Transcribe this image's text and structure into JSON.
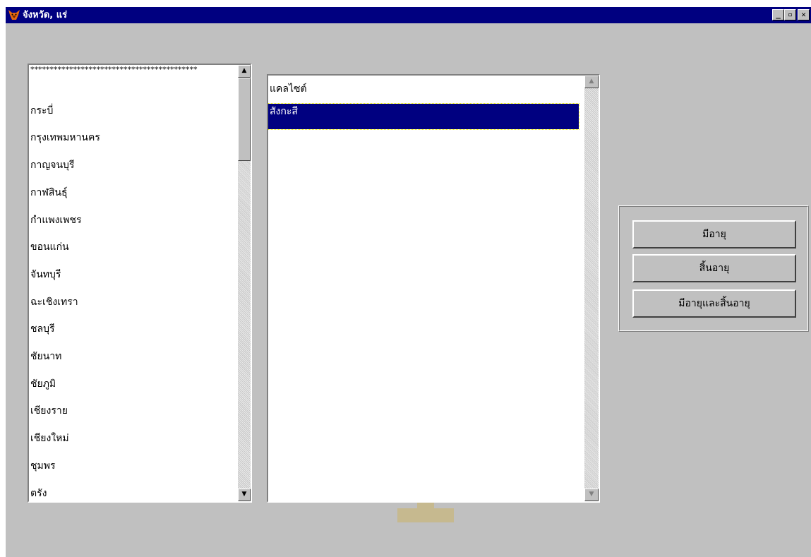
{
  "window": {
    "title": "จังหวัด, แร่",
    "controls": {
      "minimize": "_",
      "maximize": "▫",
      "close": "✕"
    }
  },
  "province_list": {
    "items": [
      "*******************************************",
      "กระบี่",
      "กรุงเทพมหานคร",
      "กาญจนบุรี",
      "กาฬสินธุ์",
      "กำแพงเพชร",
      "ขอนแก่น",
      "จันทบุรี",
      "ฉะเชิงเทรา",
      "ชลบุรี",
      "ชัยนาท",
      "ชัยภูมิ",
      "เชียงราย",
      "เชียงใหม่",
      "ชุมพร",
      "ตรัง"
    ]
  },
  "mineral_list": {
    "items": [
      "แคลไซต์",
      "สังกะสี"
    ],
    "selected": "สังกะสี"
  },
  "scrollbar": {
    "up_glyph": "▲",
    "down_glyph": "▼"
  },
  "status_buttons": {
    "active_label": "มีอายุ",
    "expired_label": "สิ้นอายุ",
    "both_label": "มีอายุและสิ้นอายุ"
  },
  "colors": {
    "titlebar": "#000080",
    "window_bg": "#c0c0c0",
    "selection": "#000080"
  },
  "icons": {
    "app": "fox-icon",
    "minimize": "minimize-icon",
    "maximize": "maximize-icon",
    "close": "close-icon"
  }
}
